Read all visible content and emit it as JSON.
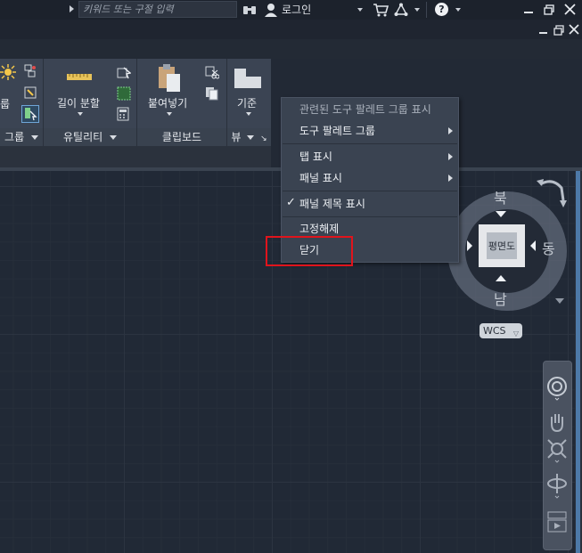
{
  "titlebar": {
    "search_placeholder": "키워드 또는 구절 입력",
    "login_label": "로그인",
    "help_icon": "help-icon"
  },
  "ribbon": {
    "group_label_partial": "그룹",
    "measure_label": "길이 분할",
    "utilities_label": "유틸리티",
    "paste_label": "붙여넣기",
    "clipboard_label": "클립보드",
    "base_label": "기준",
    "view_label": "뷰",
    "left_partial_label": "룹"
  },
  "context_menu": {
    "items": [
      {
        "label": "관련된 도구 팔레트 그룹 표시",
        "disabled": true
      },
      {
        "label": "도구 팔레트 그룹",
        "submenu": true
      },
      {
        "label": "탭 표시",
        "submenu": true
      },
      {
        "label": "패널 표시",
        "submenu": true
      },
      {
        "label": "패널 제목 표시",
        "checked": true
      },
      {
        "label": "고정해제"
      },
      {
        "label": "닫기",
        "highlighted": true
      }
    ],
    "check_mark": "✓"
  },
  "viewcube": {
    "north": "북",
    "south": "남",
    "east": "동",
    "face_label": "평면도",
    "wcs_label": "WCS"
  },
  "colors": {
    "background": "#222935",
    "highlight_border": "#e0141c",
    "menu_bg": "#3a4351"
  }
}
